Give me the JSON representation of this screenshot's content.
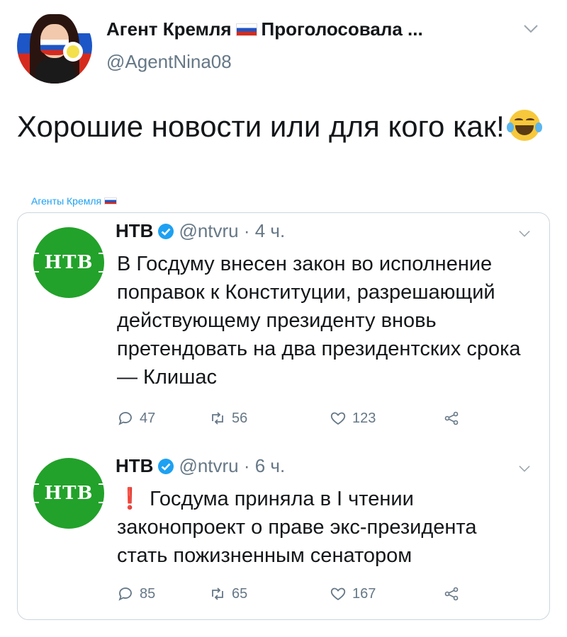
{
  "header": {
    "display_name": "Агент Кремля",
    "display_name_suffix": "Проголосовала ...",
    "handle": "@AgentNina08"
  },
  "tweet": {
    "text": "Хорошие новости или для кого как!",
    "source_label": "Агенты Кремля"
  },
  "quoted_tweets": [
    {
      "name": "НТВ",
      "handle": "@ntvru",
      "time": "4 ч.",
      "logo_text": "НТВ",
      "text": "В Госдуму внесен закон во исполнение поправок к Конституции, разрешающий действующему президенту вновь претендовать на два президентских срока — Клишас",
      "replies": "47",
      "retweets": "56",
      "likes": "123"
    },
    {
      "name": "НТВ",
      "handle": "@ntvru",
      "time": "6 ч.",
      "logo_text": "НТВ",
      "prefix": "❗",
      "text": "Госдума приняла в I чтении законопроект о праве экс-президента стать пожизненным сенатором",
      "replies": "85",
      "retweets": "65",
      "likes": "167"
    }
  ],
  "colors": {
    "ntv_green": "#22a22a",
    "link_blue": "#1da1f2",
    "muted_gray": "#657786",
    "exclamation_red": "#e0245e"
  },
  "icons": [
    "chevron-down-icon",
    "verified-badge-icon",
    "reply-icon",
    "retweet-icon",
    "like-icon",
    "share-icon",
    "russian-flag-icon",
    "tears-of-joy-emoji"
  ]
}
